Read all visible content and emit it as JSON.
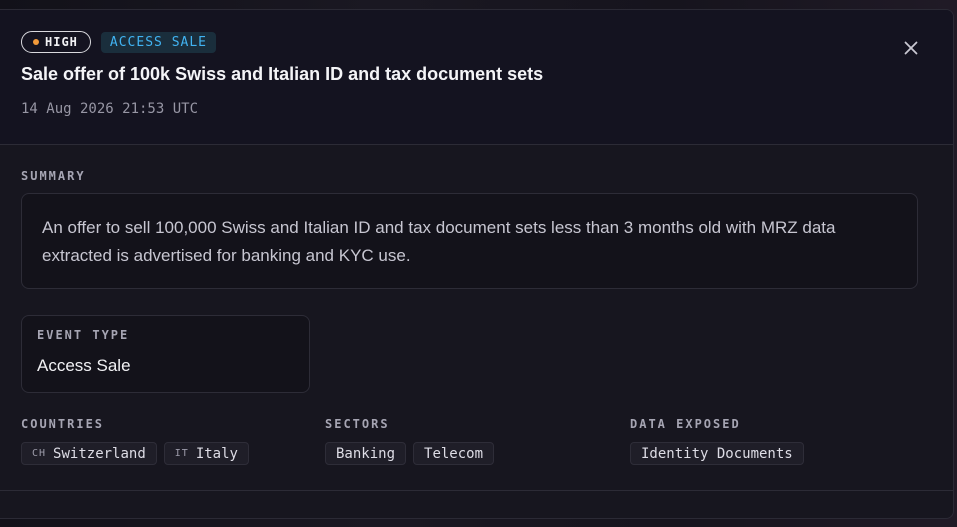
{
  "badges": {
    "severity": "HIGH",
    "type": "ACCESS SALE"
  },
  "header": {
    "title": "Sale offer of 100k Swiss and Italian ID and tax document sets",
    "timestamp": "14 Aug 2026 21:53 UTC"
  },
  "summary": {
    "label": "SUMMARY",
    "text": "An offer to sell 100,000 Swiss and Italian ID and tax document sets less than 3 months old with MRZ data extracted is advertised for banking and KYC use."
  },
  "event_type": {
    "label": "EVENT TYPE",
    "value": "Access Sale"
  },
  "countries": {
    "label": "COUNTRIES",
    "items": [
      {
        "code": "CH",
        "name": "Switzerland"
      },
      {
        "code": "IT",
        "name": "Italy"
      }
    ]
  },
  "sectors": {
    "label": "SECTORS",
    "items": [
      "Banking",
      "Telecom"
    ]
  },
  "data_exposed": {
    "label": "DATA EXPOSED",
    "items": [
      "Identity Documents"
    ]
  },
  "colors": {
    "severity_dot": "#f29a3a",
    "type_badge_text": "#41b3f2",
    "type_badge_bg": "#1a2e3c"
  },
  "icons": {
    "close": "close-icon"
  }
}
